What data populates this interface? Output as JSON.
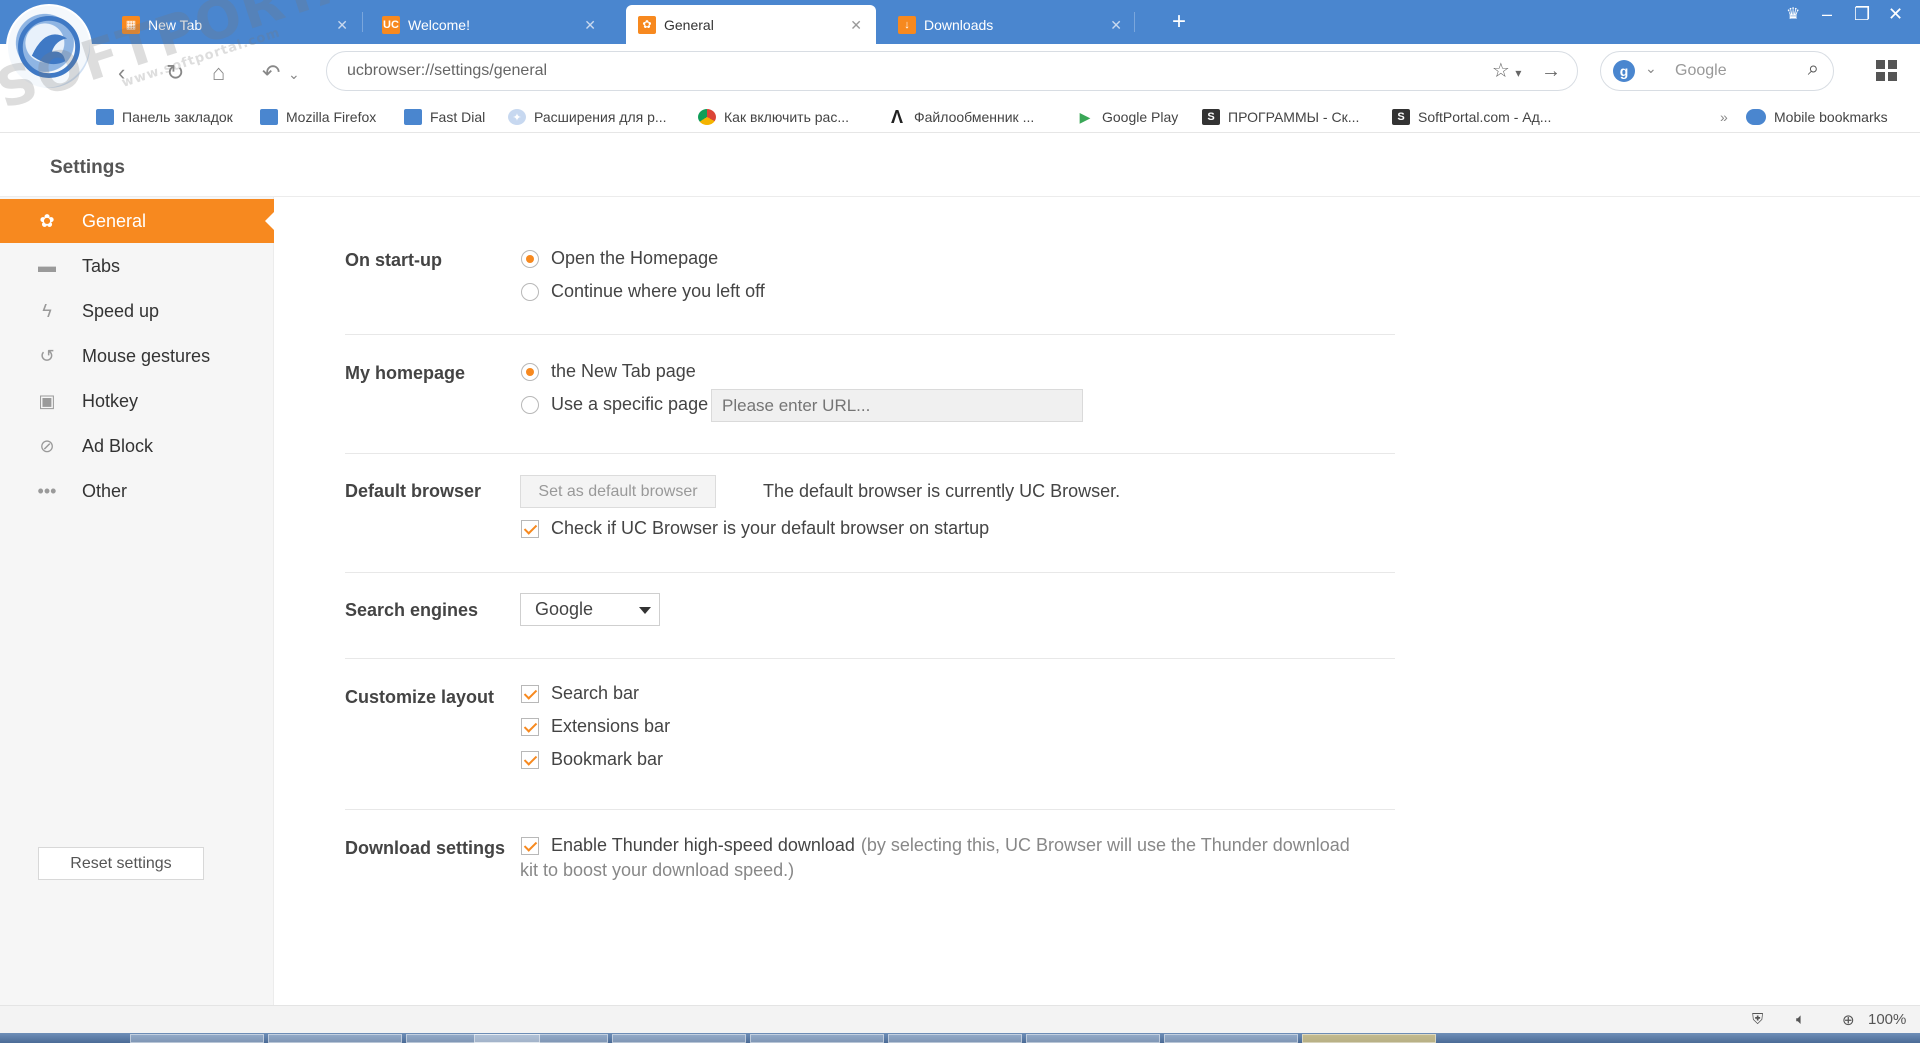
{
  "browser": {
    "tabs": [
      {
        "label": "New Tab",
        "icon": "uc-newtab-icon",
        "active": false
      },
      {
        "label": "Welcome!",
        "icon": "uc-logo-icon",
        "active": false
      },
      {
        "label": "General",
        "icon": "gear-icon",
        "active": true
      },
      {
        "label": "Downloads",
        "icon": "download-icon",
        "active": false
      }
    ],
    "new_tab_symbol": "+",
    "address": "ucbrowser://settings/general",
    "search_placeholder": "Google",
    "window_controls": [
      "–",
      "❐",
      "✕"
    ]
  },
  "bookmarks": [
    {
      "label": "Панель закладок",
      "icon": "folder-icon"
    },
    {
      "label": "Mozilla Firefox",
      "icon": "folder-icon"
    },
    {
      "label": "Fast Dial",
      "icon": "folder-icon"
    },
    {
      "label": "Расширения для р...",
      "icon": "puzzle-icon"
    },
    {
      "label": "Как включить рас...",
      "icon": "chrome-icon"
    },
    {
      "label": "Файлообменник ...",
      "icon": "lambda-icon"
    },
    {
      "label": "Google Play",
      "icon": "play-icon"
    },
    {
      "label": "ПРОГРАММЫ - Ск...",
      "icon": "softportal-icon"
    },
    {
      "label": "SoftPortal.com - Ад...",
      "icon": "softportal-icon"
    }
  ],
  "bookmarks_overflow": "»",
  "mobile_bookmarks": "Mobile bookmarks",
  "watermark": {
    "main": "SOFTPORTAL",
    "sub": "www.softportal.com"
  },
  "settings": {
    "title": "Settings",
    "nav": [
      {
        "label": "General",
        "icon": "gear-icon",
        "active": true
      },
      {
        "label": "Tabs",
        "icon": "tabs-icon",
        "active": false
      },
      {
        "label": "Speed up",
        "icon": "lightning-icon",
        "active": false
      },
      {
        "label": "Mouse gestures",
        "icon": "gesture-icon",
        "active": false
      },
      {
        "label": "Hotkey",
        "icon": "hotkey-icon",
        "active": false
      },
      {
        "label": "Ad Block",
        "icon": "block-icon",
        "active": false
      },
      {
        "label": "Other",
        "icon": "more-icon",
        "active": false
      }
    ],
    "reset_label": "Reset settings"
  },
  "general": {
    "startup": {
      "label": "On start-up",
      "options": [
        "Open the Homepage",
        "Continue where you left off"
      ],
      "selected": 0
    },
    "homepage": {
      "label": "My homepage",
      "options": [
        "the New Tab page",
        "Use a specific page"
      ],
      "selected": 0,
      "url_placeholder": "Please enter URL..."
    },
    "default_browser": {
      "label": "Default browser",
      "button": "Set as default browser",
      "status": "The default browser is currently UC Browser.",
      "check_label": "Check if UC Browser is your default browser on startup",
      "checked": true
    },
    "search_engines": {
      "label": "Search engines",
      "selected": "Google"
    },
    "layout": {
      "label": "Customize layout",
      "options": [
        {
          "label": "Search bar",
          "checked": true
        },
        {
          "label": "Extensions bar",
          "checked": true
        },
        {
          "label": "Bookmark bar",
          "checked": true
        }
      ]
    },
    "download": {
      "label": "Download settings",
      "check_label": "Enable Thunder high-speed download",
      "note_line1": "(by selecting this, UC Browser will use the Thunder download",
      "note_line2": "kit to boost your download speed.)",
      "checked": true
    }
  },
  "status": {
    "zoom": "100%"
  },
  "colors": {
    "accent": "#f7891f",
    "tabbar": "#4a86cf"
  }
}
